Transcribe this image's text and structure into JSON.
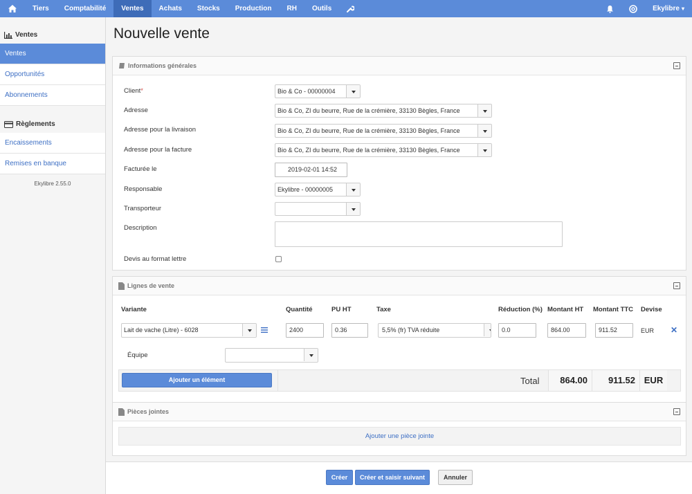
{
  "topbar": {
    "items": [
      "Tiers",
      "Comptabilité",
      "Ventes",
      "Achats",
      "Stocks",
      "Production",
      "RH",
      "Outils"
    ],
    "active": "Ventes",
    "user": "Ekylibre"
  },
  "sidebar": {
    "section1": "Ventes",
    "items1": [
      "Ventes",
      "Opportunités",
      "Abonnements"
    ],
    "section2": "Règlements",
    "items2": [
      "Encaissements",
      "Remises en banque"
    ],
    "version": "Ekylibre 2.55.0"
  },
  "page": {
    "title": "Nouvelle vente"
  },
  "general": {
    "title": "Informations générales",
    "client_label": "Client",
    "client_required": "*",
    "client_value": "Bio & Co - 00000004",
    "address_label": "Adresse",
    "address_value": "Bio & Co, ZI du beurre, Rue de la crémière, 33130 Bègles, France",
    "delivery_label": "Adresse pour la livraison",
    "delivery_value": "Bio & Co, ZI du beurre, Rue de la crémière, 33130 Bègles, France",
    "invoice_label": "Adresse pour la facture",
    "invoice_value": "Bio & Co, ZI du beurre, Rue de la crémière, 33130 Bègles, France",
    "invoiced_label": "Facturée le",
    "invoiced_value": "2019-02-01 14:52",
    "responsible_label": "Responsable",
    "responsible_value": "Ekylibre - 00000005",
    "carrier_label": "Transporteur",
    "carrier_value": "",
    "description_label": "Description",
    "letter_label": "Devis au format lettre"
  },
  "lines": {
    "title": "Lignes de vente",
    "headers": {
      "variant": "Variante",
      "quantity": "Quantité",
      "unit_price": "PU HT",
      "tax": "Taxe",
      "reduction": "Réduction (%)",
      "amount": "Montant HT",
      "amount_tax": "Montant TTC",
      "currency": "Devise"
    },
    "row": {
      "variant": "Lait de vache (Litre) - 6028",
      "quantity": "2400",
      "unit_price": "0.36",
      "tax": "5,5% (fr) TVA réduite",
      "reduction": "0.0",
      "amount": "864.00",
      "amount_tax": "911.52",
      "currency": "EUR"
    },
    "team_label": "Équipe",
    "add_button": "Ajouter un élément",
    "total_label": "Total",
    "total_amount": "864.00",
    "total_amount_tax": "911.52",
    "total_currency": "EUR"
  },
  "attachments": {
    "title": "Pièces jointes",
    "add_link": "Ajouter une pièce jointe"
  },
  "actions": {
    "create": "Créer",
    "create_next": "Créer et saisir suivant",
    "cancel": "Annuler"
  },
  "colors": {
    "accent": "#5b8bd9",
    "accent_dark": "#3e6cb8",
    "link": "#3d6fc4"
  }
}
